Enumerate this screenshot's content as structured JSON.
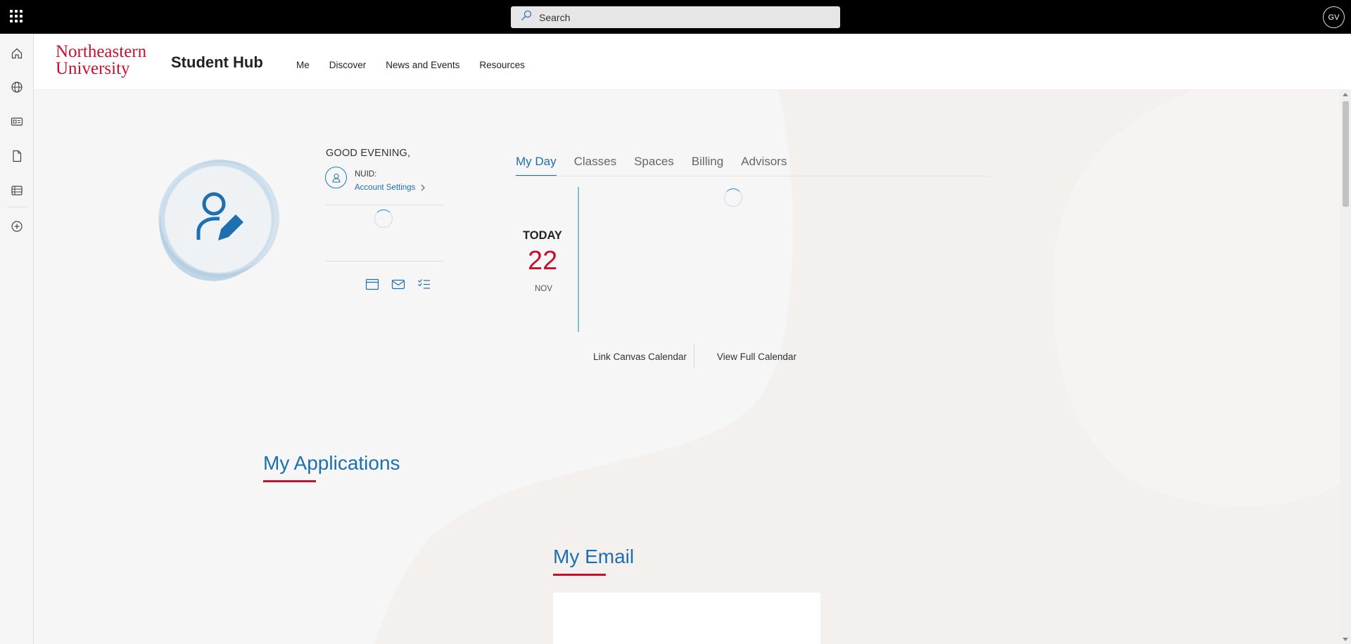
{
  "suitebar": {
    "search_placeholder": "Search",
    "avatar_initials": "GV"
  },
  "leftrail": {
    "items": [
      "home-icon",
      "globe-icon",
      "news-icon",
      "document-icon",
      "table-icon",
      "add-icon"
    ]
  },
  "header": {
    "logo_line1": "Northeastern",
    "logo_line2": "University",
    "title": "Student Hub",
    "nav": [
      "Me",
      "Discover",
      "News and Events",
      "Resources"
    ]
  },
  "profile": {
    "greeting": "GOOD EVENING,",
    "nuid_label": "NUID:",
    "account_settings": "Account Settings"
  },
  "tabs": [
    "My Day",
    "Classes",
    "Spaces",
    "Billing",
    "Advisors"
  ],
  "active_tab": "My Day",
  "today": {
    "label": "TODAY",
    "day": "22",
    "month": "NOV"
  },
  "calendar_links": {
    "link_canvas": "Link Canvas Calendar",
    "view_full": "View Full Calendar"
  },
  "sections": {
    "applications": "My Applications",
    "email": "My Email"
  },
  "colors": {
    "brand_red": "#c8102e",
    "brand_blue": "#1e6fb0",
    "suitebar": "#000000"
  }
}
